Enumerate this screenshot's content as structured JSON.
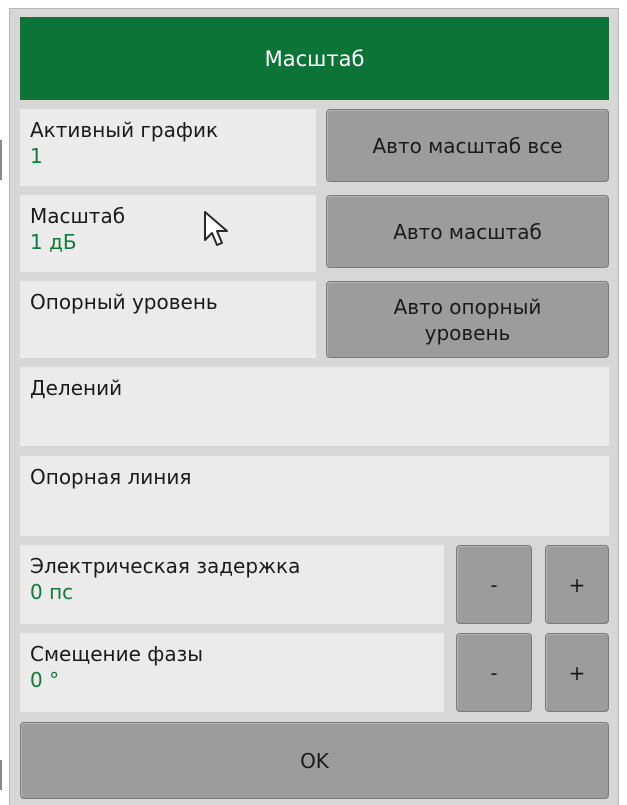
{
  "dialog": {
    "title": "Масштаб",
    "active_trace": {
      "label": "Активный график",
      "value": "1"
    },
    "scale": {
      "label": "Масштаб",
      "value": "1 дБ"
    },
    "ref_level": {
      "label": "Опорный уровень"
    },
    "divisions": {
      "label": "Делений"
    },
    "ref_line": {
      "label": "Опорная линия"
    },
    "electrical_delay": {
      "label": "Электрическая задержка",
      "value": "0 пс"
    },
    "phase_offset": {
      "label": "Смещение фазы",
      "value": "0 °"
    },
    "buttons": {
      "auto_scale_all": "Авто масштаб все",
      "auto_scale": "Авто масштаб",
      "auto_ref_level": "Авто опорный уровень",
      "minus": "-",
      "plus": "+",
      "ok": "OK"
    }
  },
  "colors": {
    "header_bg": "#0b7436",
    "value_text": "#127a3a",
    "button_bg": "#9c9c9c",
    "field_bg": "#ebebeb",
    "panel_bg": "#d7d7d7"
  },
  "icons": [
    "mouse-pointer-icon"
  ]
}
